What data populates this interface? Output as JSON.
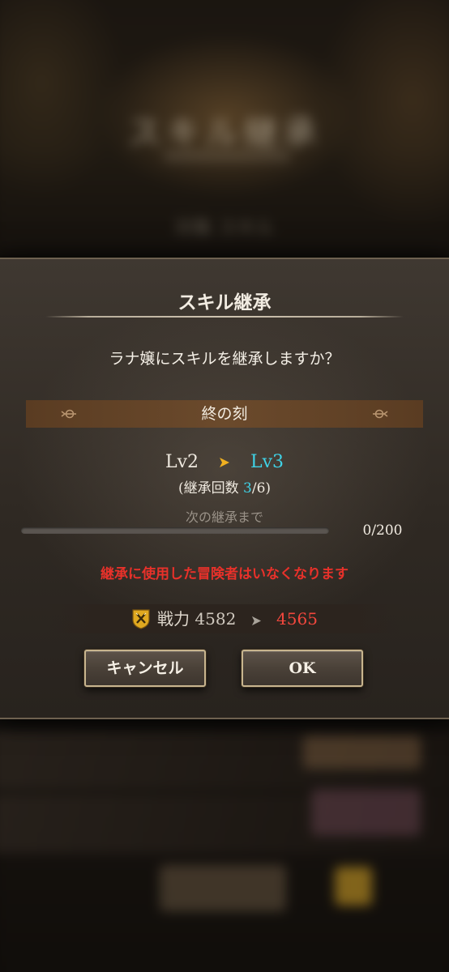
{
  "background": {
    "title": "スキル継承",
    "sub": "対象 スキル"
  },
  "dialog": {
    "title": "スキル継承",
    "question": "ラナ嬢にスキルを継承しますか？",
    "skill_name": "終の刻",
    "level": {
      "from": "Lv2",
      "to": "Lv3"
    },
    "inherit_count": {
      "prefix": "(継承回数 ",
      "current": "3",
      "suffix": "/6)"
    },
    "next_label": "次の継承まで",
    "progress": {
      "text": "0/200",
      "fraction": 0.0
    },
    "warning": "継承に使用した冒険者はいなくなります",
    "power": {
      "label": "戦力",
      "from": "4582",
      "to": "4565",
      "icon": "crossed-swords-shield-icon"
    },
    "buttons": {
      "cancel": "キャンセル",
      "ok": "OK"
    }
  },
  "colors": {
    "accent_cyan": "#3fd2e6",
    "warning_red": "#e8312a",
    "power_red": "#f2473d",
    "arrow_gold": "#f0b020",
    "button_border": "#c8b58e"
  }
}
